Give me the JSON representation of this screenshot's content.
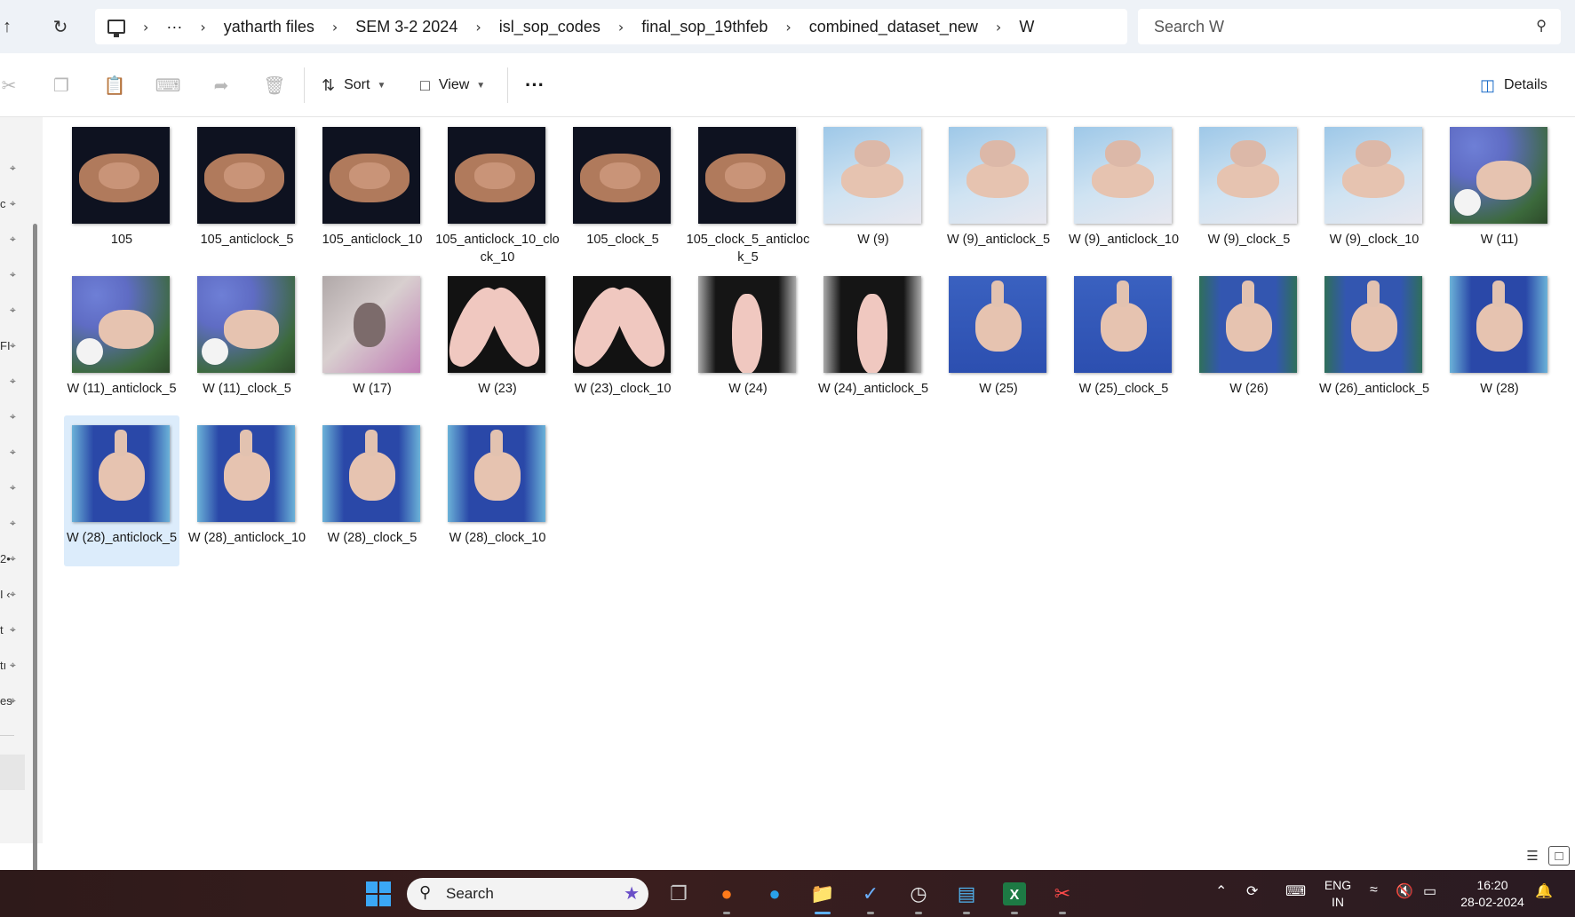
{
  "address_bar": {
    "breadcrumbs": [
      "yatharth files",
      "SEM 3-2 2024",
      "isl_sop_codes",
      "final_sop_19thfeb",
      "combined_dataset_new",
      "W"
    ],
    "overflow_label": "···",
    "search_placeholder": "Search W"
  },
  "toolbar": {
    "sort_label": "Sort",
    "view_label": "View",
    "more_label": "···",
    "details_label": "Details"
  },
  "nav_pane": {
    "stubs": [
      "",
      "c",
      "",
      "",
      "",
      "FI",
      "",
      "",
      "",
      "",
      "",
      "2•",
      "I ‹",
      "t",
      "tı",
      "es"
    ]
  },
  "files": [
    {
      "name": "105",
      "thumb": "dark"
    },
    {
      "name": "105_anticlock_5",
      "thumb": "dark"
    },
    {
      "name": "105_anticlock_10",
      "thumb": "dark"
    },
    {
      "name": "105_anticlock_10_clock_10",
      "thumb": "dark"
    },
    {
      "name": "105_clock_5",
      "thumb": "dark"
    },
    {
      "name": "105_clock_5_anticlock_5",
      "thumb": "dark"
    },
    {
      "name": "W (9)",
      "thumb": "sky"
    },
    {
      "name": "W (9)_anticlock_5",
      "thumb": "sky"
    },
    {
      "name": "W (9)_anticlock_10",
      "thumb": "sky"
    },
    {
      "name": "W (9)_clock_5",
      "thumb": "sky"
    },
    {
      "name": "W (9)_clock_10",
      "thumb": "sky"
    },
    {
      "name": "W (11)",
      "thumb": "flow"
    },
    {
      "name": "W (11)_anticlock_5",
      "thumb": "flow"
    },
    {
      "name": "W (11)_clock_5",
      "thumb": "flow"
    },
    {
      "name": "W (17)",
      "thumb": "pink"
    },
    {
      "name": "W (23)",
      "thumb": "black"
    },
    {
      "name": "W (23)_clock_10",
      "thumb": "black"
    },
    {
      "name": "W (24)",
      "thumb": "gray"
    },
    {
      "name": "W (24)_anticlock_5",
      "thumb": "gray"
    },
    {
      "name": "W (25)",
      "thumb": "blue1"
    },
    {
      "name": "W (25)_clock_5",
      "thumb": "blue1"
    },
    {
      "name": "W (26)",
      "thumb": "blue2"
    },
    {
      "name": "W (26)_anticlock_5",
      "thumb": "blue2"
    },
    {
      "name": "W (28)",
      "thumb": "blue3"
    },
    {
      "name": "W (28)_anticlock_5",
      "thumb": "blue3",
      "selected": true
    },
    {
      "name": "W (28)_anticlock_10",
      "thumb": "blue3"
    },
    {
      "name": "W (28)_clock_5",
      "thumb": "blue3"
    },
    {
      "name": "W (28)_clock_10",
      "thumb": "blue3"
    }
  ],
  "taskbar": {
    "search_label": "Search",
    "lang_line1": "ENG",
    "lang_line2": "IN",
    "time": "16:20",
    "date": "28-02-2024",
    "apps": [
      "start-icon",
      "task-view-icon",
      "firefox-icon",
      "edge-icon",
      "file-explorer-icon",
      "todo-icon",
      "clock-icon",
      "notepad-icon",
      "excel-icon",
      "snipping-tool-icon"
    ]
  }
}
